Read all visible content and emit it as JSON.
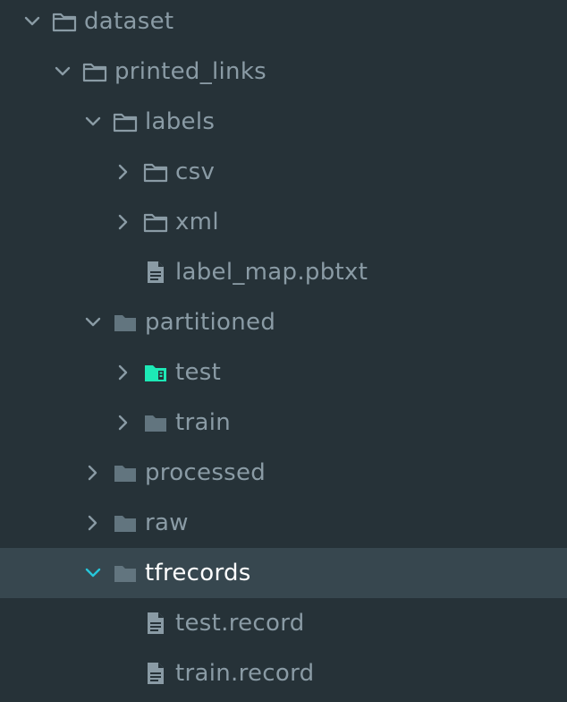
{
  "colors": {
    "background": "#263238",
    "selected_row": "#37474f",
    "text": "#8a9ba5",
    "text_selected": "#ffffff",
    "chevron": "#8a9ba5",
    "chevron_selected": "#26c6da",
    "folder": "#62757f",
    "folder_test": "#1de9b6"
  },
  "tree": [
    {
      "label": "dataset",
      "depth": 0,
      "chevron": "expanded",
      "icon": "folder-open-icon",
      "selected": false
    },
    {
      "label": "printed_links",
      "depth": 1,
      "chevron": "expanded",
      "icon": "folder-open-icon",
      "selected": false
    },
    {
      "label": "labels",
      "depth": 2,
      "chevron": "expanded",
      "icon": "folder-open-icon",
      "selected": false
    },
    {
      "label": "csv",
      "depth": 3,
      "chevron": "collapsed",
      "icon": "folder-outline-icon",
      "selected": false
    },
    {
      "label": "xml",
      "depth": 3,
      "chevron": "collapsed",
      "icon": "folder-outline-icon",
      "selected": false
    },
    {
      "label": "label_map.pbtxt",
      "depth": 3,
      "chevron": "none",
      "icon": "file-text-icon",
      "selected": false
    },
    {
      "label": "partitioned",
      "depth": 2,
      "chevron": "expanded",
      "icon": "folder-filled-icon",
      "selected": false
    },
    {
      "label": "test",
      "depth": 3,
      "chevron": "collapsed",
      "icon": "folder-test-icon",
      "selected": false
    },
    {
      "label": "train",
      "depth": 3,
      "chevron": "collapsed",
      "icon": "folder-filled-icon",
      "selected": false
    },
    {
      "label": "processed",
      "depth": 2,
      "chevron": "collapsed",
      "icon": "folder-filled-icon",
      "selected": false
    },
    {
      "label": "raw",
      "depth": 2,
      "chevron": "collapsed",
      "icon": "folder-filled-icon",
      "selected": false
    },
    {
      "label": "tfrecords",
      "depth": 2,
      "chevron": "expanded",
      "icon": "folder-filled-icon",
      "selected": true
    },
    {
      "label": "test.record",
      "depth": 3,
      "chevron": "none",
      "icon": "file-text-icon",
      "selected": false
    },
    {
      "label": "train.record",
      "depth": 3,
      "chevron": "none",
      "icon": "file-text-icon",
      "selected": false
    }
  ]
}
